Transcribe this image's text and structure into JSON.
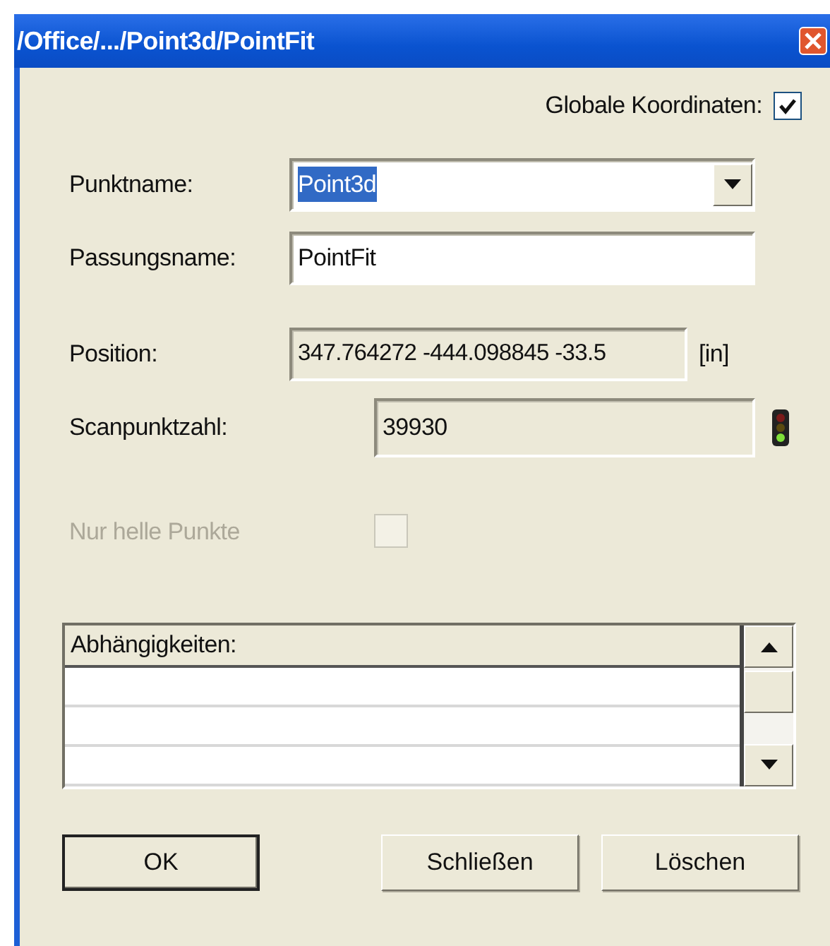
{
  "window": {
    "title": "/Office/.../Point3d/PointFit"
  },
  "global_coordinates": {
    "label": "Globale Koordinaten:",
    "checked": true
  },
  "point_name": {
    "label": "Punktname:",
    "value": "Point3d",
    "text_selected": true
  },
  "fit_name": {
    "label": "Passungsname:",
    "value": "PointFit"
  },
  "position": {
    "label": "Position:",
    "value": "347.764272 -444.098845 -33.5",
    "unit": "[in]"
  },
  "scan_point_count": {
    "label": "Scanpunktzahl:",
    "value": "39930"
  },
  "bright_points_only": {
    "label": "Nur helle Punkte",
    "checked": false,
    "disabled": true
  },
  "dependencies": {
    "header": "Abhängigkeiten:"
  },
  "buttons": [
    {
      "label": "OK",
      "default": true
    },
    {
      "label": "Schließen",
      "default": false
    },
    {
      "label": "Löschen",
      "default": false
    }
  ]
}
